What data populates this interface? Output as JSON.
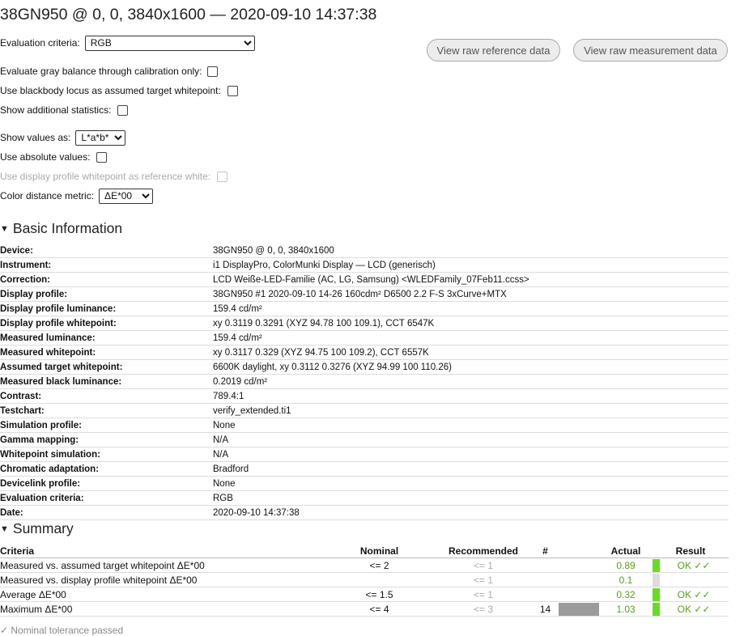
{
  "title": "38GN950 @ 0, 0, 3840x1600 — 2020-09-10 14:37:38",
  "options": {
    "evaluation_criteria_label": "Evaluation criteria:",
    "evaluation_criteria_value": "RGB",
    "gray_balance_label": "Evaluate gray balance through calibration only:",
    "blackbody_label": "Use blackbody locus as assumed target whitepoint:",
    "additional_stats_label": "Show additional statistics:",
    "show_values_label": "Show values as:",
    "show_values_value": "L*a*b*",
    "absolute_values_label": "Use absolute values:",
    "profile_whitepoint_label": "Use display profile whitepoint as reference white:",
    "color_distance_label": "Color distance metric:",
    "color_distance_value": "ΔE*00"
  },
  "buttons": {
    "raw_reference": "View raw reference data",
    "raw_measurement": "View raw measurement data"
  },
  "basic_info": {
    "heading": "Basic Information",
    "rows": [
      {
        "label": "Device:",
        "value": "38GN950 @ 0, 0, 3840x1600"
      },
      {
        "label": "Instrument:",
        "value": "i1 DisplayPro, ColorMunki Display — LCD (generisch)"
      },
      {
        "label": "Correction:",
        "value": "LCD Weiße-LED-Familie (AC, LG, Samsung) <WLEDFamily_07Feb11.ccss>"
      },
      {
        "label": "Display profile:",
        "value": "38GN950 #1 2020-09-10 14-26 160cdm² D6500 2.2 F-S 3xCurve+MTX"
      },
      {
        "label": "Display profile luminance:",
        "value": "159.4 cd/m²"
      },
      {
        "label": "Display profile whitepoint:",
        "value": "xy 0.3119 0.3291 (XYZ 94.78 100 109.1), CCT 6547K"
      },
      {
        "label": "Measured luminance:",
        "value": "159.4 cd/m²"
      },
      {
        "label": "Measured whitepoint:",
        "value": "xy 0.3117 0.329 (XYZ 94.75 100 109.2), CCT 6557K"
      },
      {
        "label": "Assumed target whitepoint:",
        "value": "6600K daylight, xy 0.3112 0.3276 (XYZ 94.99 100 110.26)"
      },
      {
        "label": "Measured black luminance:",
        "value": "0.2019 cd/m²"
      },
      {
        "label": "Contrast:",
        "value": "789.4:1"
      },
      {
        "label": "Testchart:",
        "value": "verify_extended.ti1"
      },
      {
        "label": "Simulation profile:",
        "value": "None"
      },
      {
        "label": "Gamma mapping:",
        "value": "N/A"
      },
      {
        "label": "Whitepoint simulation:",
        "value": "N/A"
      },
      {
        "label": "Chromatic adaptation:",
        "value": "Bradford"
      },
      {
        "label": "Devicelink profile:",
        "value": "None"
      },
      {
        "label": "Evaluation criteria:",
        "value": "RGB"
      },
      {
        "label": "Date:",
        "value": "2020-09-10 14:37:38"
      }
    ]
  },
  "summary": {
    "heading": "Summary",
    "headers": {
      "criteria": "Criteria",
      "nominal": "Nominal",
      "recommended": "Recommended",
      "count": "#",
      "actual": "Actual",
      "result": "Result"
    },
    "rows": [
      {
        "criteria": "Measured vs. assumed target whitepoint ΔE*00",
        "nominal": "<= 2",
        "recommended": "<= 1",
        "count": "",
        "bar_fraction": 0,
        "actual": "0.89",
        "result": "OK ✓✓",
        "mark_color": "#66dd22"
      },
      {
        "criteria": "Measured vs. display profile whitepoint ΔE*00",
        "nominal": "",
        "recommended": "<= 1",
        "count": "",
        "bar_fraction": 0,
        "actual": "0.1",
        "result": "",
        "mark_color": "#dddddd"
      },
      {
        "criteria": "Average ΔE*00",
        "nominal": "<= 1.5",
        "recommended": "<= 1",
        "count": "",
        "bar_fraction": 0,
        "actual": "0.32",
        "result": "OK ✓✓",
        "mark_color": "#66dd22"
      },
      {
        "criteria": "Maximum ΔE*00",
        "nominal": "<= 4",
        "recommended": "<= 3",
        "count": "14",
        "bar_fraction": 1,
        "actual": "1.03",
        "result": "OK ✓✓",
        "mark_color": "#66dd22"
      }
    ]
  },
  "footer": "✓ Nominal tolerance passed"
}
